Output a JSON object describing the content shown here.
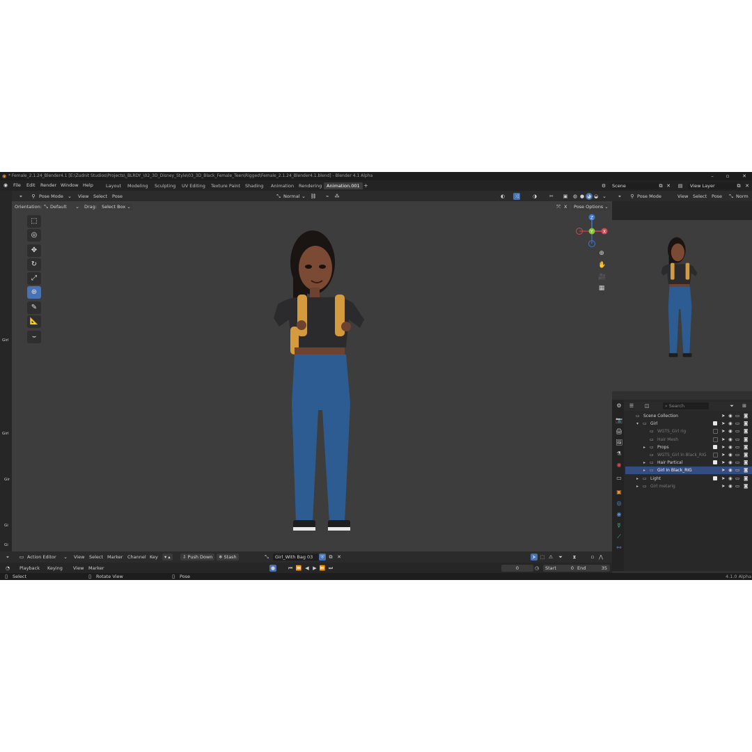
{
  "window": {
    "title": "* Female_2.1.24_Blender4.1 [E:\\Zudnit Studios\\Projects\\_BLRDY_\\02_3D_Disney_Style\\03_3D_Black_Female_Teen\\Rigged\\Female_2.1.24_Blender4.1.blend] - Blender 4.1 Alpha"
  },
  "menu": [
    "File",
    "Edit",
    "Render",
    "Window",
    "Help"
  ],
  "workspaces": [
    "Layout",
    "Modeling",
    "Sculpting",
    "UV Editing",
    "Texture Paint",
    "Shading",
    "Animation",
    "Rendering",
    "Animation.001"
  ],
  "workspace_add": "+",
  "scene": {
    "scene_label": "Scene",
    "view_layer_label": "View Layer"
  },
  "viewport": {
    "mode": "Pose Mode",
    "menus": [
      "View",
      "Select",
      "Pose"
    ],
    "orientation_label": "Orientation:",
    "orientation_value": "Default",
    "drag_label": "Drag:",
    "drag_value": "Select Box",
    "transform_orientation": "Normal",
    "pose_options": "Pose Options",
    "x_label": "X"
  },
  "gizmo": {
    "x": "X",
    "y": "Y",
    "z": "Z"
  },
  "preview_header": {
    "mode": "Pose Mode",
    "menus": [
      "View",
      "Select",
      "Pose"
    ],
    "extra": "Norm"
  },
  "left_strip": [
    "Girl",
    "Girl",
    "Gir",
    "Gi",
    "Gi"
  ],
  "outliner": {
    "search_placeholder": "Search",
    "rows": [
      {
        "label": "Scene Collection",
        "indent": 0,
        "arrow": "",
        "dim": false,
        "selected": false,
        "checked": null
      },
      {
        "label": "Girl",
        "indent": 1,
        "arrow": "▾",
        "dim": false,
        "selected": false,
        "checked": true
      },
      {
        "label": "WGTS_Girl rig",
        "indent": 2,
        "arrow": "",
        "dim": true,
        "selected": false,
        "checked": false
      },
      {
        "label": "Hair Mesh",
        "indent": 2,
        "arrow": "",
        "dim": true,
        "selected": false,
        "checked": false
      },
      {
        "label": "Props",
        "indent": 2,
        "arrow": "▸",
        "dim": false,
        "selected": false,
        "checked": true
      },
      {
        "label": "WGTS_Girl In Black_RIG",
        "indent": 2,
        "arrow": "",
        "dim": true,
        "selected": false,
        "checked": false
      },
      {
        "label": "Hair Partical",
        "indent": 2,
        "arrow": "▸",
        "dim": false,
        "selected": false,
        "checked": true
      },
      {
        "label": "Girl In Black_RIG",
        "indent": 2,
        "arrow": "▸",
        "dim": false,
        "selected": true,
        "checked": null
      },
      {
        "label": "Light",
        "indent": 1,
        "arrow": "▸",
        "dim": false,
        "selected": false,
        "checked": true
      },
      {
        "label": "Girl metarig",
        "indent": 1,
        "arrow": "▸",
        "dim": true,
        "selected": false,
        "checked": null
      }
    ]
  },
  "action_editor": {
    "mode": "Action Editor",
    "menus": [
      "View",
      "Select",
      "Marker",
      "Channel",
      "Key"
    ],
    "push_down": "Push Down",
    "stash": "Stash",
    "action_name": "Girl_With Bag 03"
  },
  "timeline": {
    "menus": [
      "Playback",
      "Keying",
      "View",
      "Marker"
    ],
    "current_frame": "0",
    "start_label": "Start",
    "start_value": "0",
    "end_label": "End",
    "end_value": "35"
  },
  "statusbar": {
    "select": "Select",
    "rotate": "Rotate View",
    "pose": "Pose",
    "version": "4.1.0 Alpha"
  },
  "colors": {
    "accent": "#4772b3",
    "viewport_bg": "#3d3d3d",
    "panel_bg": "#303030",
    "header_bg": "#2b2b2b"
  }
}
